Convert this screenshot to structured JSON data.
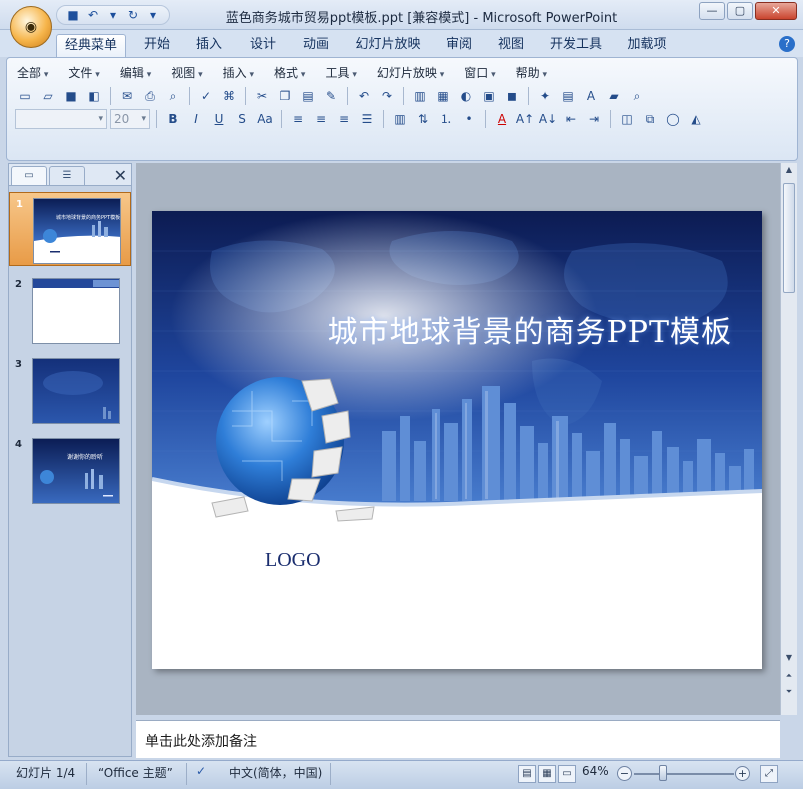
{
  "window": {
    "title": "蓝色商务城市贸易ppt模板.ppt [兼容模式] - Microsoft PowerPoint",
    "office_button_icon": "office-logo"
  },
  "ribbon_tabs": [
    "经典菜单",
    "开始",
    "插入",
    "设计",
    "动画",
    "幻灯片放映",
    "审阅",
    "视图",
    "开发工具",
    "加载项"
  ],
  "active_tab": "经典菜单",
  "classic_menu": [
    "全部",
    "文件",
    "编辑",
    "视图",
    "插入",
    "格式",
    "工具",
    "幻灯片放映",
    "窗口",
    "帮助"
  ],
  "format_bar": {
    "font_name": "",
    "font_size": "20"
  },
  "slides": [
    {
      "number": "1",
      "thumb_title": "城市地球背景的商务PPT模板"
    },
    {
      "number": "2",
      "thumb_title": ""
    },
    {
      "number": "3",
      "thumb_title": ""
    },
    {
      "number": "4",
      "thumb_title": "谢谢你的聆听"
    }
  ],
  "slide": {
    "title": "城市地球背景的商务PPT模板",
    "logo": "LOGO"
  },
  "notes": {
    "placeholder": "单击此处添加备注"
  },
  "status": {
    "slide_counter": "幻灯片 1/4",
    "theme": "“Office 主题”",
    "language": "中文(简体，中国)",
    "zoom": "64%",
    "zoom_fraction": 0.64
  },
  "colors": {
    "slide_top": "#0d1f5c",
    "slide_mid": "#2a5cb0",
    "accent_selection": "#e89b47"
  }
}
